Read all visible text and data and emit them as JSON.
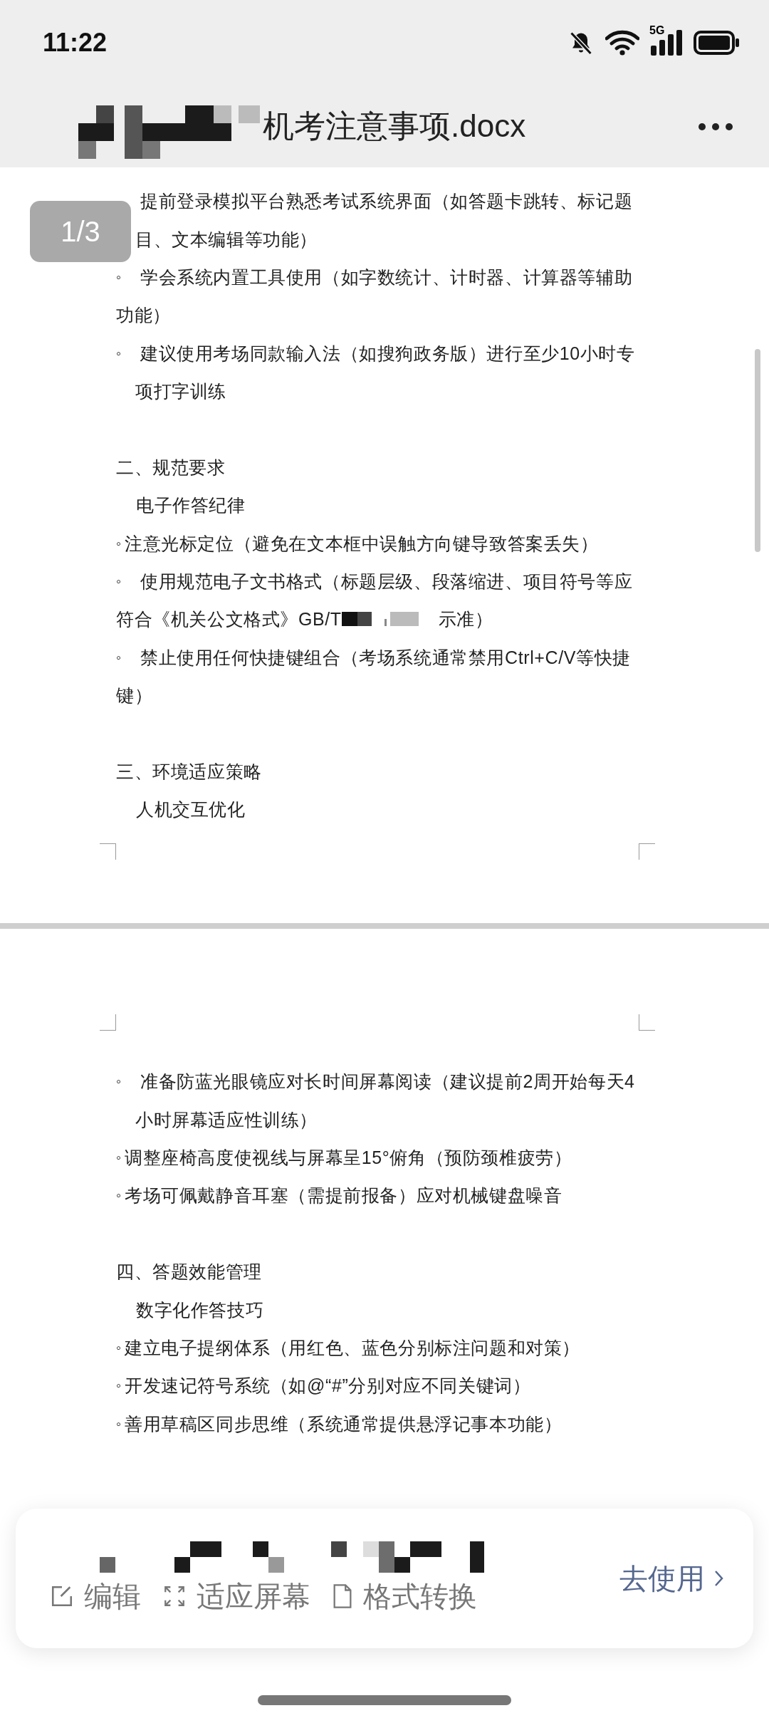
{
  "status_bar": {
    "time": "11:22",
    "network": "5G"
  },
  "header": {
    "title": "机考注意事项.docx"
  },
  "page_badge": "1/3",
  "pages": [
    {
      "lines": [
        {
          "kind": "item",
          "text": "提前登录模拟平台熟悉考试系统界面（如答题卡跳转、标记题"
        },
        {
          "kind": "cont-indent",
          "text": "目、文本编辑等功能）"
        },
        {
          "kind": "item",
          "marker": "◦",
          "text": "学会系统内置工具使用（如字数统计、计时器、计算器等辅助"
        },
        {
          "kind": "cont",
          "text": "功能）"
        },
        {
          "kind": "item",
          "marker": "◦",
          "text": "建议使用考场同款输入法（如搜狗政务版）进行至少10小时专"
        },
        {
          "kind": "cont-indent",
          "text": "项打字训练"
        },
        {
          "kind": "heading",
          "text": "二、规范要求"
        },
        {
          "kind": "sub",
          "text": "电子作答纪律"
        },
        {
          "kind": "item-tight",
          "marker": "◦",
          "text": "注意光标定位（避免在文本框中误触方向键导致答案丢失）"
        },
        {
          "kind": "item",
          "marker": "◦",
          "text": "使用规范电子文书格式（标题层级、段落缩进、项目符号等应"
        },
        {
          "kind": "redacted",
          "text": "符合《机关公文格式》GB/T",
          "tail": "示准）"
        },
        {
          "kind": "item",
          "marker": "◦",
          "text": "禁止使用任何快捷键组合（考场系统通常禁用Ctrl+C/V等快捷"
        },
        {
          "kind": "cont",
          "text": "键）"
        },
        {
          "kind": "heading",
          "text": "三、环境适应策略"
        },
        {
          "kind": "sub",
          "text": "人机交互优化"
        }
      ]
    },
    {
      "lines": [
        {
          "kind": "item",
          "marker": "◦",
          "text": "准备防蓝光眼镜应对长时间屏幕阅读（建议提前2周开始每天4"
        },
        {
          "kind": "cont-indent",
          "text": "小时屏幕适应性训练）"
        },
        {
          "kind": "item-tight",
          "marker": "◦",
          "text": "调整座椅高度使视线与屏幕呈15°俯角（预防颈椎疲劳）"
        },
        {
          "kind": "item-tight",
          "marker": "◦",
          "text": "考场可佩戴静音耳塞（需提前报备）应对机械键盘噪音"
        },
        {
          "kind": "heading",
          "text": "四、答题效能管理"
        },
        {
          "kind": "sub",
          "text": "数字化作答技巧"
        },
        {
          "kind": "item-tight",
          "marker": "◦",
          "text": "建立电子提纲体系（用红色、蓝色分别标注问题和对策）"
        },
        {
          "kind": "item-tight",
          "marker": "◦",
          "text": "开发速记符号系统（如@“#”分别对应不同关键词）"
        },
        {
          "kind": "item-tight",
          "marker": "◦",
          "text": "善用草稿区同步思维（系统通常提供悬浮记事本功能）"
        }
      ]
    }
  ],
  "bottom_card": {
    "actions": [
      {
        "label": "编辑"
      },
      {
        "label": "适应屏幕"
      },
      {
        "label": "格式转换"
      }
    ],
    "cta": "去使用"
  }
}
